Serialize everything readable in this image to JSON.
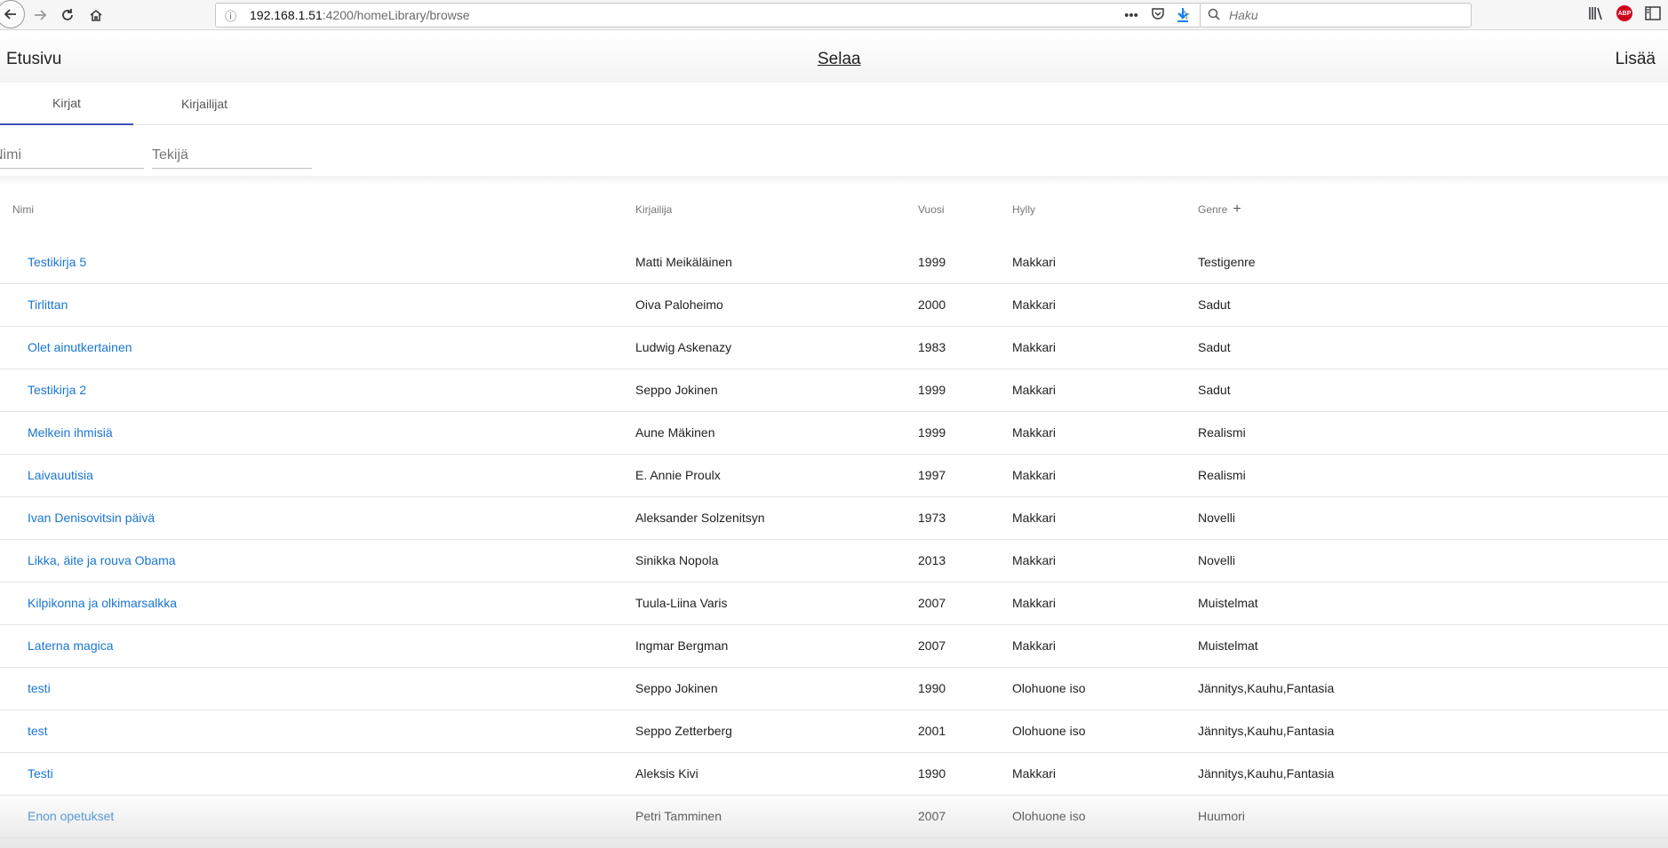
{
  "browser": {
    "url_host": "192.168.1.51",
    "url_path": ":4200/homeLibrary/browse",
    "search_placeholder": "Haku",
    "page_actions_label": "•••"
  },
  "header": {
    "home_label": "Etusivu",
    "browse_label": "Selaa",
    "add_label": "Lisää"
  },
  "tabs": [
    {
      "label": "Kirjat"
    },
    {
      "label": "Kirjailijat"
    }
  ],
  "filters": {
    "name_placeholder": "Nimi",
    "author_placeholder": "Tekijä"
  },
  "table": {
    "columns": {
      "name": "Nimi",
      "author": "Kirjailija",
      "year": "Vuosi",
      "shelf": "Hylly",
      "genre": "Genre",
      "genre_add_icon": "+"
    },
    "rows": [
      {
        "name": "Testikirja 5",
        "author": "Matti Meikäläinen",
        "year": "1999",
        "shelf": "Makkari",
        "genre": "Testigenre"
      },
      {
        "name": "Tirlittan",
        "author": "Oiva Paloheimo",
        "year": "2000",
        "shelf": "Makkari",
        "genre": "Sadut"
      },
      {
        "name": "Olet ainutkertainen",
        "author": "Ludwig Askenazy",
        "year": "1983",
        "shelf": "Makkari",
        "genre": "Sadut"
      },
      {
        "name": "Testikirja 2",
        "author": "Seppo Jokinen",
        "year": "1999",
        "shelf": "Makkari",
        "genre": "Sadut"
      },
      {
        "name": "Melkein ihmisiä",
        "author": "Aune Mäkinen",
        "year": "1999",
        "shelf": "Makkari",
        "genre": "Realismi"
      },
      {
        "name": "Laivauutisia",
        "author": "E. Annie Proulx",
        "year": "1997",
        "shelf": "Makkari",
        "genre": "Realismi"
      },
      {
        "name": "Ivan Denisovitsin päivä",
        "author": "Aleksander Solzenitsyn",
        "year": "1973",
        "shelf": "Makkari",
        "genre": "Novelli"
      },
      {
        "name": "Likka, äite ja rouva Obama",
        "author": "Sinikka Nopola",
        "year": "2013",
        "shelf": "Makkari",
        "genre": "Novelli"
      },
      {
        "name": "Kilpikonna ja olkimarsalkka",
        "author": "Tuula-Liina Varis",
        "year": "2007",
        "shelf": "Makkari",
        "genre": "Muistelmat"
      },
      {
        "name": "Laterna magica",
        "author": "Ingmar Bergman",
        "year": "2007",
        "shelf": "Makkari",
        "genre": "Muistelmat"
      },
      {
        "name": "testi",
        "author": "Seppo Jokinen",
        "year": "1990",
        "shelf": "Olohuone iso",
        "genre": "Jännitys,Kauhu,Fantasia"
      },
      {
        "name": "test",
        "author": "Seppo Zetterberg",
        "year": "2001",
        "shelf": "Olohuone iso",
        "genre": "Jännitys,Kauhu,Fantasia"
      },
      {
        "name": "Testi",
        "author": "Aleksis Kivi",
        "year": "1990",
        "shelf": "Makkari",
        "genre": "Jännitys,Kauhu,Fantasia"
      },
      {
        "name": "Enon opetukset",
        "author": "Petri Tamminen",
        "year": "2007",
        "shelf": "Olohuone iso",
        "genre": "Huumori"
      }
    ]
  },
  "colors": {
    "link": "#1976d2",
    "tab_indicator": "#3f51b5",
    "download_accent": "#0a84ff",
    "adblock_badge": "#d0021b"
  },
  "icons": [
    "back-icon",
    "forward-icon",
    "reload-icon",
    "home-icon",
    "info-icon",
    "pocket-icon",
    "bookmark-star-icon",
    "download-icon",
    "search-icon",
    "library-icon",
    "adblock-icon",
    "sidebar-icon"
  ]
}
